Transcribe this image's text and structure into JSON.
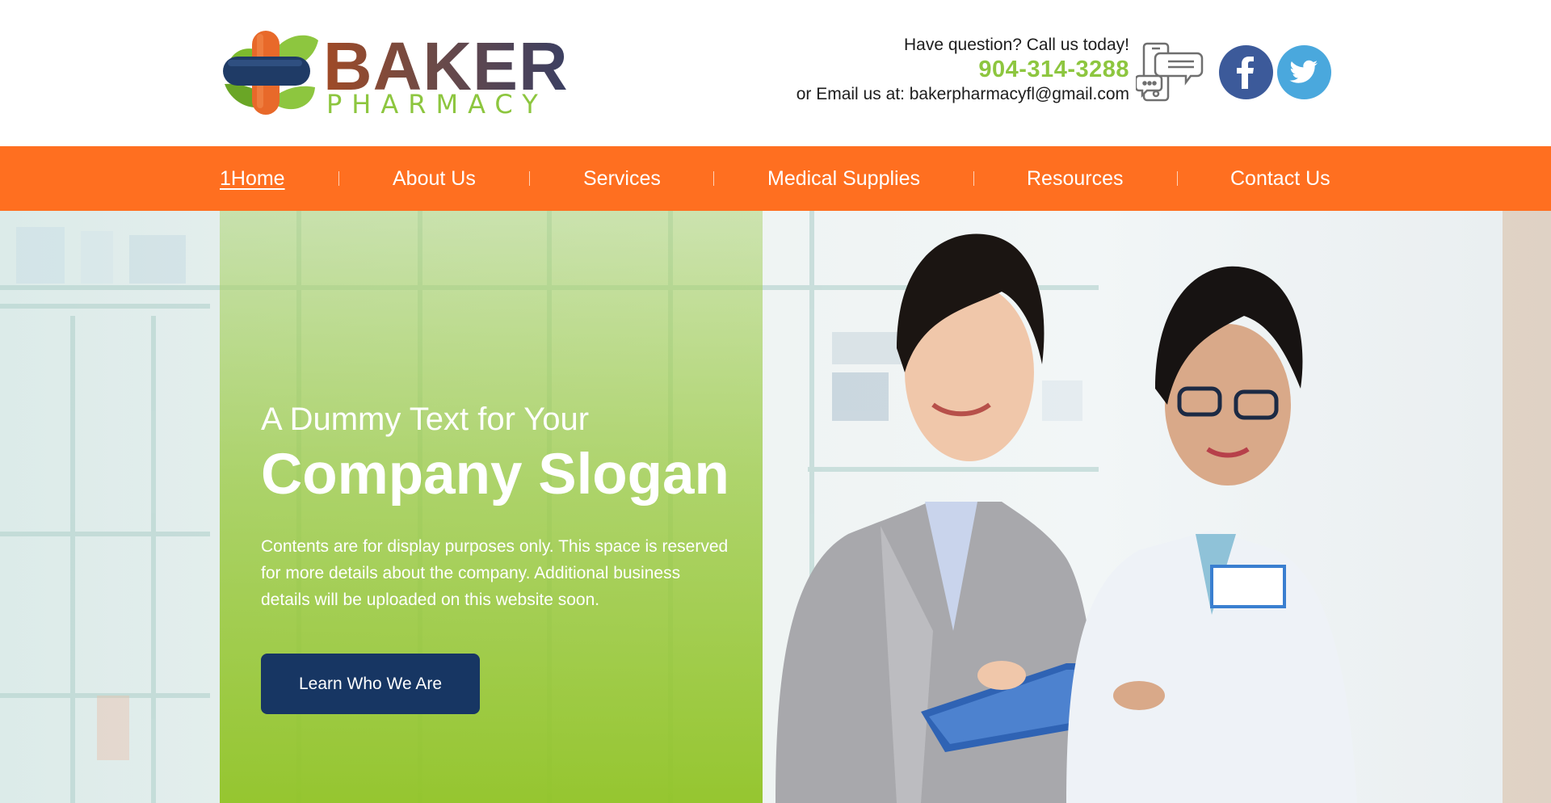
{
  "brand": {
    "name": "BAKER",
    "subtitle": "PHARMACY"
  },
  "header": {
    "question": "Have question? Call us today!",
    "phone": "904-314-3288",
    "email_line": "or Email us at: bakerpharmacyfl@gmail.com"
  },
  "social": [
    {
      "name": "facebook",
      "icon": "facebook-icon",
      "color": "#3c5a9a"
    },
    {
      "name": "twitter",
      "icon": "twitter-icon",
      "color": "#4aa8dd"
    }
  ],
  "nav": {
    "items": [
      {
        "label": "1Home",
        "active": true
      },
      {
        "label": "About Us"
      },
      {
        "label": "Services"
      },
      {
        "label": "Medical Supplies"
      },
      {
        "label": "Resources"
      },
      {
        "label": "Contact Us"
      }
    ]
  },
  "hero": {
    "slogan_small": "A Dummy Text for Your",
    "slogan_big": "Company Slogan",
    "description": "Contents are for display purposes only. This space is reserved for more details about the company. Additional business details will be uploaded on this website soon.",
    "cta_label": "Learn Who We Are"
  },
  "colors": {
    "nav_bg": "#ff6f20",
    "accent_green": "#8dc63f",
    "cta_bg": "#173663",
    "brand_brown": "#6b4a3f"
  }
}
